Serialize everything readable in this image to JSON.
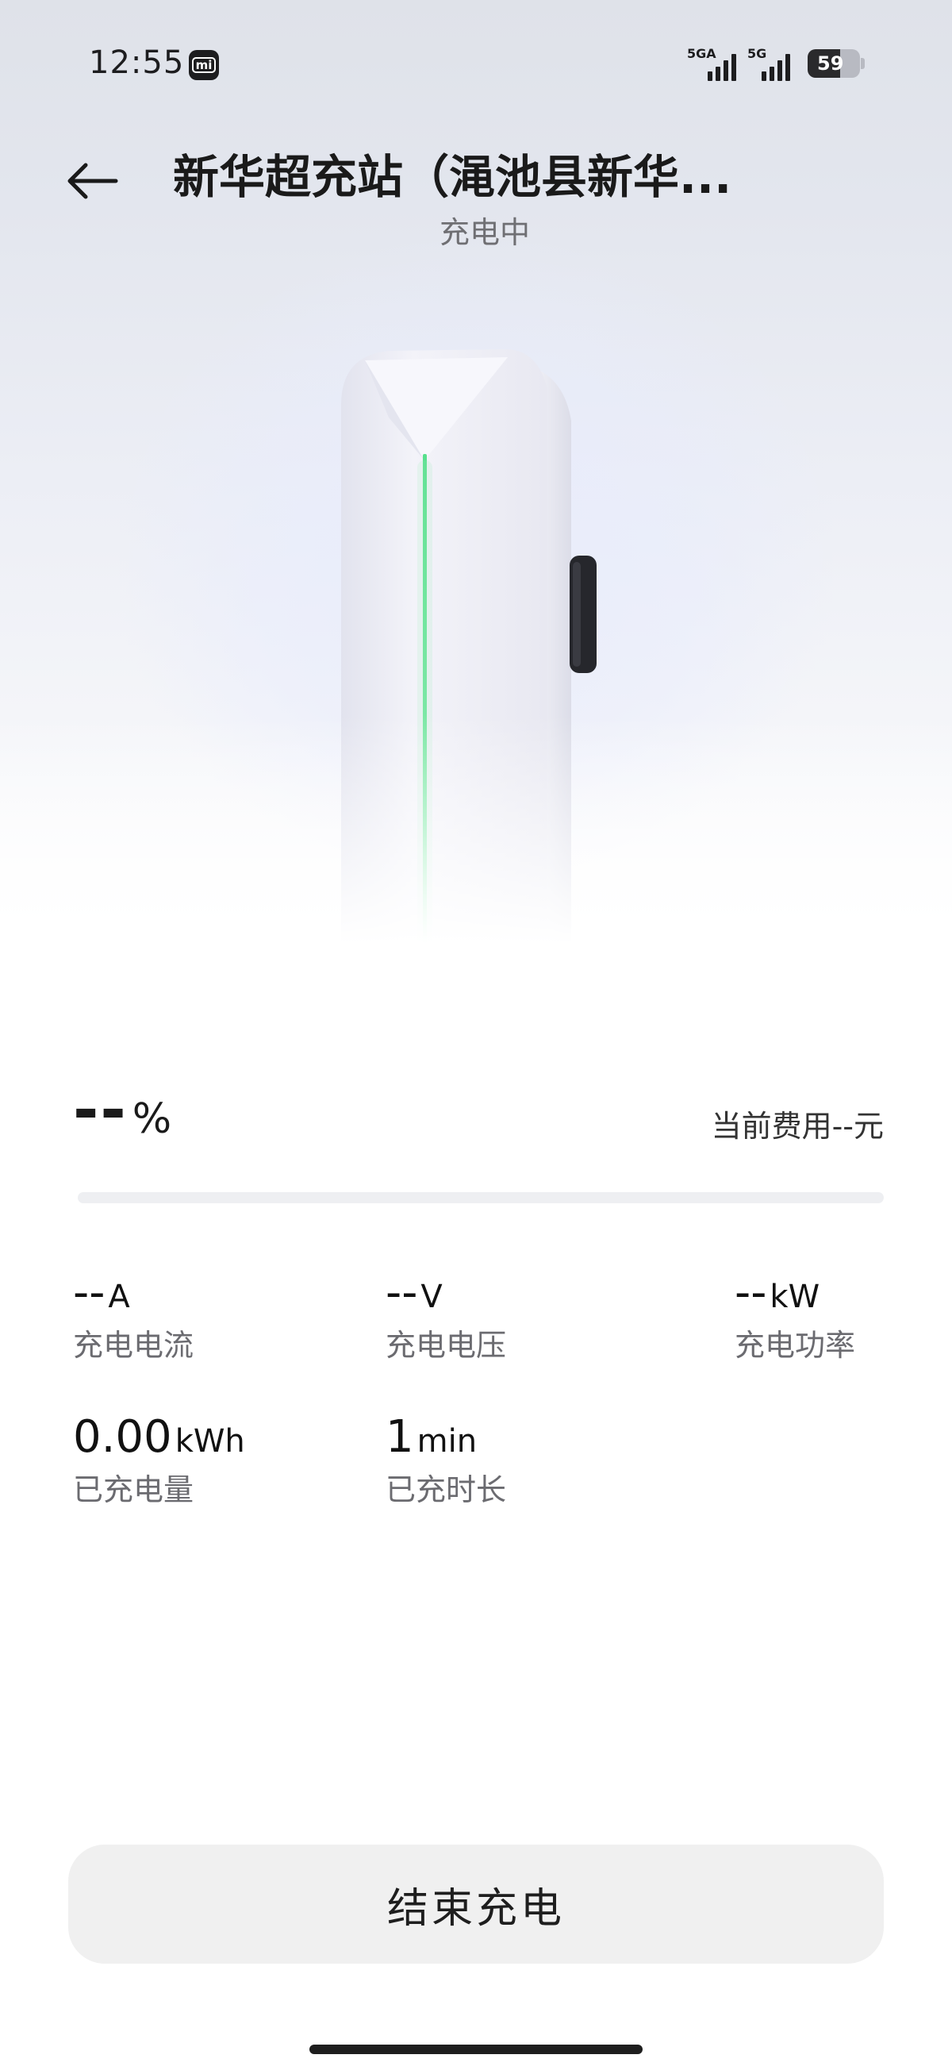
{
  "status_bar": {
    "time": "12:55",
    "mi_badge": "mi",
    "sim1_network": "5GA",
    "sim2_network": "5G",
    "battery_level": "59",
    "battery_fraction": 0.59
  },
  "header": {
    "title": "新华超充站（渑池县新华...",
    "status": "充电中"
  },
  "charging": {
    "percent_value": "--",
    "percent_unit": "%",
    "fee_text": "当前费用--元",
    "progress_fraction": 0
  },
  "metrics": {
    "current": {
      "value": "--",
      "unit": "A",
      "label": "充电电流"
    },
    "voltage": {
      "value": "--",
      "unit": "V",
      "label": "充电电压"
    },
    "power": {
      "value": "--",
      "unit": "kW",
      "label": "充电功率"
    },
    "energy": {
      "value": "0.00",
      "unit": "kWh",
      "label": "已充电量"
    },
    "duration": {
      "value": "1",
      "unit": "min",
      "label": "已充时长"
    }
  },
  "actions": {
    "end_label": "结束充电"
  },
  "colors": {
    "accent_green": "#3ad07a",
    "button_bg": "#f0f0f0"
  }
}
